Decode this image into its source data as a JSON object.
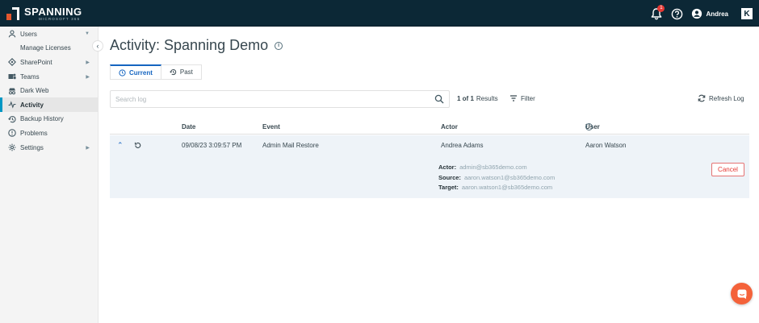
{
  "header": {
    "logo_title": "SPANNING",
    "logo_subtitle": "MICROSOFT 365",
    "notification_count": "1",
    "user_name": "Andrea",
    "vendor_mark": "K"
  },
  "sidebar": {
    "items": [
      {
        "label": "Users",
        "icon": "person-icon",
        "has_arrow": true
      },
      {
        "label": "Manage Licenses",
        "sub": true
      },
      {
        "label": "SharePoint",
        "icon": "sharepoint-icon",
        "has_arrow": true
      },
      {
        "label": "Teams",
        "icon": "teams-icon",
        "has_arrow": true
      },
      {
        "label": "Dark Web",
        "icon": "spy-icon"
      },
      {
        "label": "Activity",
        "icon": "pulse-icon",
        "active": true
      },
      {
        "label": "Backup History",
        "icon": "history-icon"
      },
      {
        "label": "Problems",
        "icon": "info-circle-icon"
      },
      {
        "label": "Settings",
        "icon": "gear-icon",
        "has_arrow": true
      }
    ]
  },
  "main": {
    "title": "Activity: Spanning Demo",
    "tabs": [
      {
        "label": "Current",
        "active": true
      },
      {
        "label": "Past"
      }
    ],
    "search_placeholder": "Search log",
    "results": {
      "count": "1 of 1",
      "suffix": "Results"
    },
    "filter_label": "Filter",
    "refresh_label": "Refresh Log",
    "columns": {
      "date": "Date",
      "event": "Event",
      "actor": "Actor",
      "user": "User"
    },
    "rows": [
      {
        "date": "09/08/23 3:09:57 PM",
        "event": "Admin Mail Restore",
        "actor": "Andrea Adams",
        "user": "Aaron Watson",
        "details": {
          "actor_label": "Actor:",
          "actor_value": "admin@sb365demo.com",
          "source_label": "Source:",
          "source_value": "aaron.watson1@sb365demo.com",
          "target_label": "Target:",
          "target_value": "aaron.watson1@sb365demo.com"
        },
        "cancel_label": "Cancel"
      }
    ]
  },
  "colors": {
    "topbar": "#0c2836",
    "accent": "#1565c0",
    "active_indicator": "#0097c4",
    "danger": "#e53935",
    "chat": "#f4623a"
  }
}
